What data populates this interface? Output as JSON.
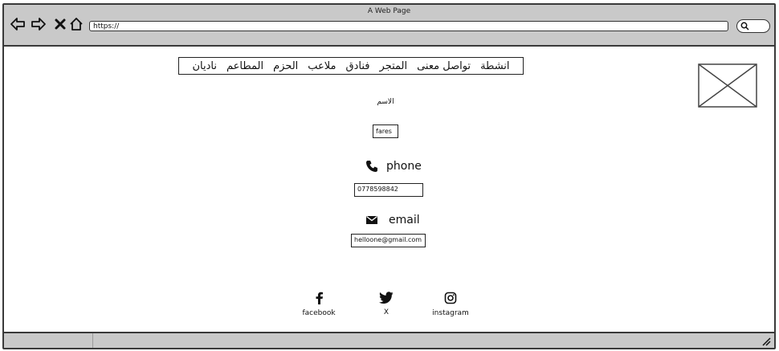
{
  "window": {
    "title": "A Web Page",
    "url": "https://"
  },
  "nav": {
    "back_icon": "back-arrow-icon",
    "forward_icon": "forward-arrow-icon",
    "close_icon": "close-icon",
    "home_icon": "home-icon",
    "search_icon": "search-icon"
  },
  "menu": {
    "items": [
      "ناديان",
      "المطاعم",
      "الحزم",
      "ملاعب",
      "فنادق",
      "المتجر",
      "تواصل معنى",
      "انشطة"
    ]
  },
  "form": {
    "name_label": "الاسم",
    "name_value": "fares",
    "phone_label": "phone",
    "phone_value": "0778598842",
    "email_label": "email",
    "email_value": "helloone@gmail.com"
  },
  "social": {
    "facebook": "facebook",
    "x": "X",
    "instagram": "instagram"
  },
  "colors": {
    "chrome": "#c9c9c9",
    "border": "#3a3a3a"
  }
}
